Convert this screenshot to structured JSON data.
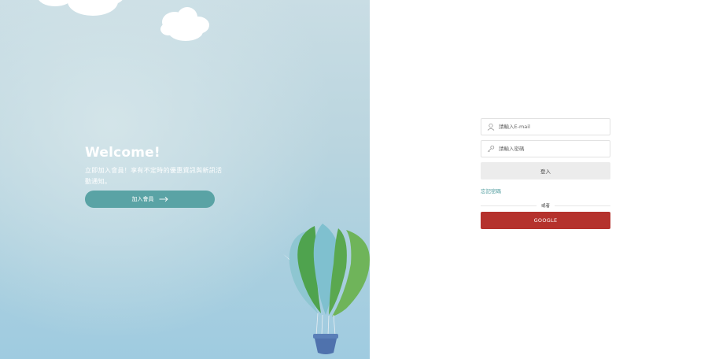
{
  "hero": {
    "title": "Welcome!",
    "description": "立即加入會員！享有不定時的優惠資訊與新訊活動通知。",
    "join_button_label": "加入會員",
    "join_button_icon": "arrow-right-icon",
    "accent_color": "#5aa3a5"
  },
  "login_form": {
    "email_placeholder": "請輸入E-mail",
    "email_icon": "user-icon",
    "password_placeholder": "請輸入密碼",
    "password_icon": "key-icon",
    "login_button_label": "登入",
    "forgot_password_label": "忘記密碼",
    "or_label": "或者",
    "google_button_label": "GOOGLE",
    "google_button_color": "#b5322d"
  }
}
